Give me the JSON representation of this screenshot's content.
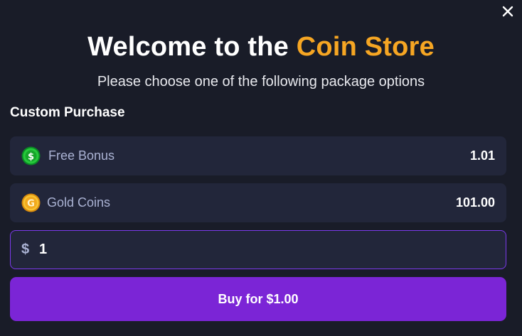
{
  "modal": {
    "close_icon": "close-icon",
    "title_prefix": "Welcome to the ",
    "title_accent": "Coin Store",
    "subtitle": "Please choose one of the following package options",
    "section_title": "Custom Purchase"
  },
  "packages": [
    {
      "icon": "sweep-coin-icon",
      "label": "Free Bonus",
      "value": "1.01"
    },
    {
      "icon": "gold-coin-icon",
      "label": "Gold Coins",
      "value": "101.00"
    }
  ],
  "amount": {
    "currency_symbol": "$",
    "value": "1"
  },
  "buy_button": {
    "label": "Buy for $1.00"
  },
  "colors": {
    "background": "#191c28",
    "card": "#22263a",
    "accent_orange": "#f6a623",
    "purple": "#7b25d6",
    "purple_border": "#7c3aed",
    "muted_text": "#aab2d3"
  }
}
